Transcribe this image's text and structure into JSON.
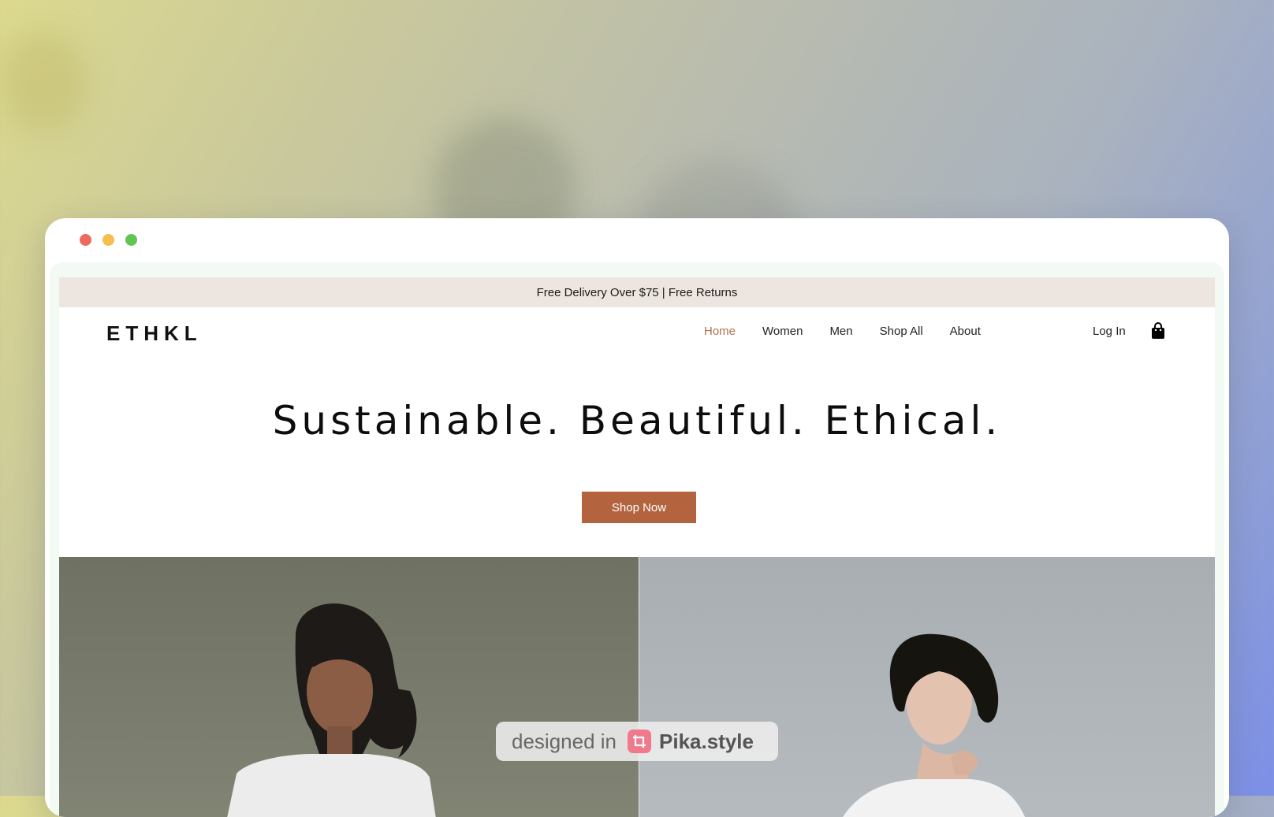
{
  "window": {
    "controls": [
      "close",
      "minimize",
      "maximize"
    ]
  },
  "announcement": {
    "text": "Free Delivery Over $75 | Free Returns"
  },
  "header": {
    "logo": "ETHKL",
    "nav": [
      {
        "label": "Home",
        "active": true
      },
      {
        "label": "Women",
        "active": false
      },
      {
        "label": "Men",
        "active": false
      },
      {
        "label": "Shop All",
        "active": false
      },
      {
        "label": "About",
        "active": false
      }
    ],
    "login_label": "Log In",
    "cart_icon": "shopping-bag-icon"
  },
  "hero": {
    "title": "Sustainable. Beautiful. Ethical.",
    "cta_label": "Shop Now"
  },
  "panels": [
    {
      "name": "women-photo",
      "description_icon": "woman-portrait"
    },
    {
      "name": "men-photo",
      "description_icon": "man-portrait"
    }
  ],
  "watermark": {
    "prefix": "designed in",
    "brand": "Pika.style",
    "icon": "crop-icon"
  },
  "colors": {
    "accent": "#b3643f",
    "active_nav": "#b0714e",
    "announcement_bg": "#ede5df",
    "women_panel_bg": "#777a6b",
    "men_panel_bg": "#b0b5b9"
  }
}
